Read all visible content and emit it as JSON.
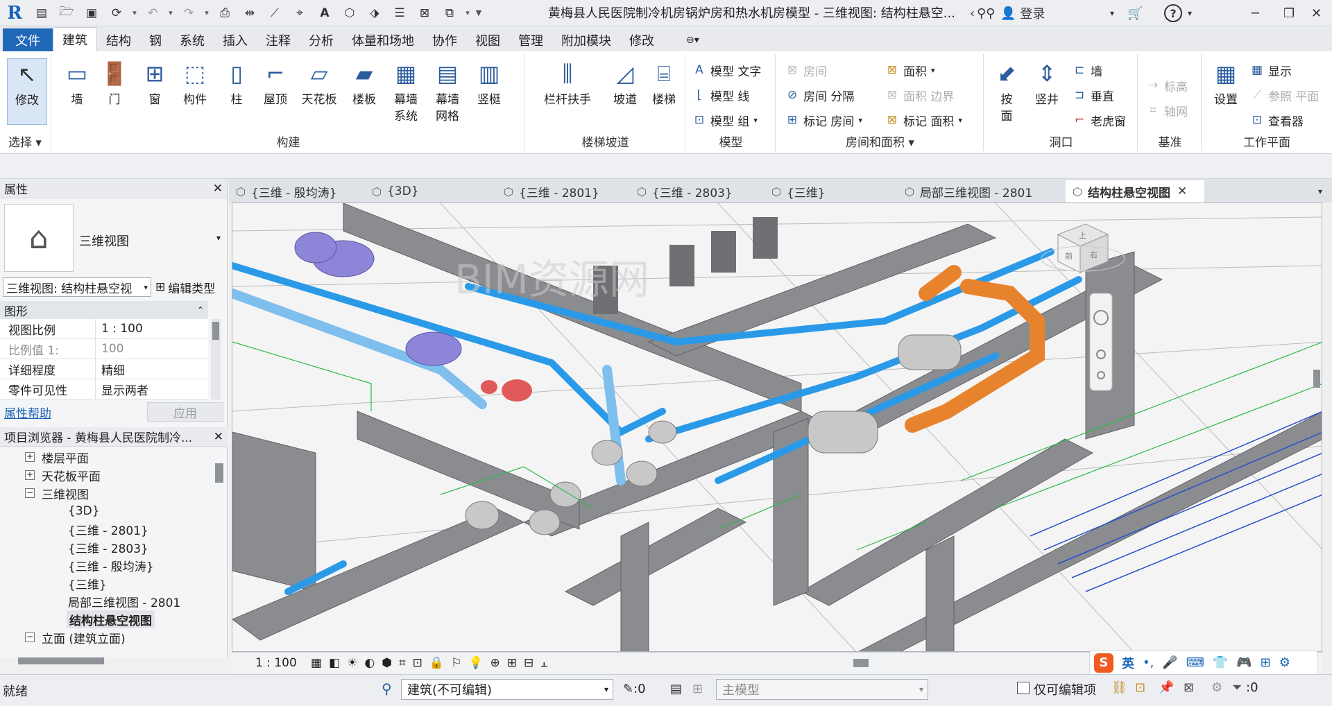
{
  "app": {
    "title": "黄梅县人民医院制冷机房锅炉房和热水机房模型 - 三维视图: 结构柱悬空...",
    "user": "登录"
  },
  "tabs": [
    "文件",
    "建筑",
    "结构",
    "钢",
    "系统",
    "插入",
    "注释",
    "分析",
    "体量和场地",
    "协作",
    "视图",
    "管理",
    "附加模块",
    "修改"
  ],
  "ribbon": {
    "select": {
      "modify": "修改",
      "label": "选择 ▾"
    },
    "build": {
      "label": "构建",
      "items": [
        {
          "icon": "wall-icon",
          "label": "墙"
        },
        {
          "icon": "door-icon",
          "label": "门"
        },
        {
          "icon": "window-icon",
          "label": "窗"
        },
        {
          "icon": "component-icon",
          "label": "构件"
        },
        {
          "icon": "column-icon",
          "label": "柱"
        },
        {
          "icon": "roof-icon",
          "label": "屋顶"
        },
        {
          "icon": "ceiling-icon",
          "label": "天花板"
        },
        {
          "icon": "floor-icon",
          "label": "楼板"
        },
        {
          "icon": "curtain-system-icon",
          "label": "幕墙\n系统"
        },
        {
          "icon": "curtain-grid-icon",
          "label": "幕墙\n网格"
        },
        {
          "icon": "mullion-icon",
          "label": "竖梃"
        }
      ]
    },
    "stairs": {
      "label": "楼梯坡道",
      "items": [
        {
          "icon": "railing-icon",
          "label": "栏杆扶手"
        },
        {
          "icon": "ramp-icon",
          "label": "坡道"
        },
        {
          "icon": "stair-icon",
          "label": "楼梯"
        }
      ]
    },
    "model": {
      "label": "模型",
      "text": "模型 文字",
      "line": "模型 线",
      "group": "模型 组"
    },
    "room": {
      "label": "房间和面积 ▾",
      "room": "房间",
      "separator": "房间 分隔",
      "tag_room": "标记 房间",
      "area": "面积",
      "area_boundary": "面积 边界",
      "tag_area": "标记 面积"
    },
    "opening": {
      "label": "洞口",
      "by_face": "按\n面",
      "shaft": "竖井",
      "wall": "墙",
      "vertical": "垂直",
      "dormer": "老虎窗"
    },
    "datum": {
      "label": "基准",
      "level": "标高",
      "grid": "轴网"
    },
    "workplane": {
      "label": "工作平面",
      "set": "设置",
      "show": "显示",
      "ref_plane": "参照 平面",
      "viewer": "查看器"
    }
  },
  "properties": {
    "header": "属性",
    "type_name": "三维视图",
    "instance": "三维视图: 结构柱悬空视",
    "edit_type": "编辑类型",
    "group": "图形",
    "rows": [
      {
        "k": "视图比例",
        "v": "1 : 100"
      },
      {
        "k": "比例值 1:",
        "v": "100"
      },
      {
        "k": "详细程度",
        "v": "精细"
      },
      {
        "k": "零件可见性",
        "v": "显示两者"
      }
    ],
    "help": "属性帮助",
    "apply": "应用"
  },
  "browser": {
    "header": "项目浏览器 - 黄梅县人民医院制冷...",
    "items": [
      {
        "label": "楼层平面",
        "toggle": "+",
        "level": 1
      },
      {
        "label": "天花板平面",
        "toggle": "+",
        "level": 1
      },
      {
        "label": "三维视图",
        "toggle": "−",
        "level": 1
      },
      {
        "label": "{3D}",
        "level": 2
      },
      {
        "label": "{三维 - 2801}",
        "level": 2
      },
      {
        "label": "{三维 - 2803}",
        "level": 2
      },
      {
        "label": "{三维 - 殷均涛}",
        "level": 2
      },
      {
        "label": "{三维}",
        "level": 2
      },
      {
        "label": "局部三维视图 - 2801",
        "level": 2
      },
      {
        "label": "结构柱悬空视图",
        "level": 2,
        "selected": true
      },
      {
        "label": "立面 (建筑立面)",
        "toggle": "−",
        "level": 1
      }
    ]
  },
  "viewtabs": [
    {
      "label": "{三维 - 殷均涛}"
    },
    {
      "label": "{3D}"
    },
    {
      "label": "{三维 - 2801}"
    },
    {
      "label": "{三维 - 2803}"
    },
    {
      "label": "{三维}"
    },
    {
      "label": "局部三维视图 - 2801"
    },
    {
      "label": "结构柱悬空视图",
      "active": true
    }
  ],
  "viewport": {
    "watermark": "BIM资源网",
    "viewcube": {
      "front": "前",
      "right": "右",
      "top": "上"
    }
  },
  "viewbar": {
    "scale": "1 : 100",
    "ime": "英"
  },
  "status": {
    "ready": "就绪",
    "workset": "建筑(不可编辑)",
    "count": ":0",
    "model": "主模型",
    "editable_only": "仅可编辑项",
    "filter_count": ":0"
  },
  "colors": {
    "accent": "#2068b8",
    "pipe_blue": "#2a9ae8",
    "pipe_orange": "#e7832d",
    "wall_grey": "#8a8c90"
  }
}
